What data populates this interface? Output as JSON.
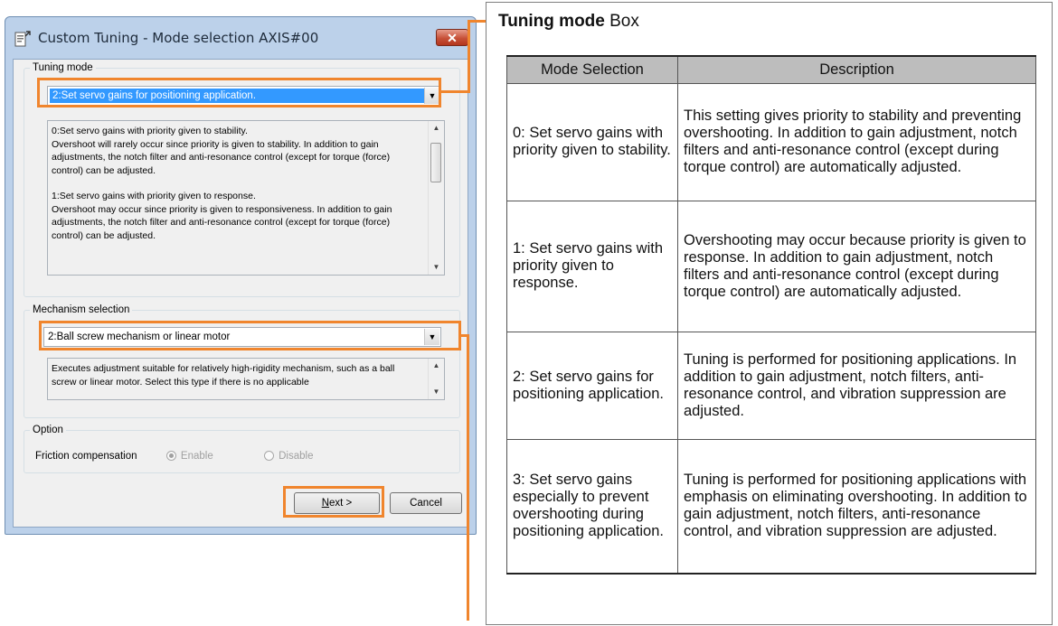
{
  "dialog": {
    "title": "Custom Tuning - Mode selection AXIS#00",
    "close_label": "✕",
    "tuning_mode": {
      "legend": "Tuning mode",
      "selected": "2:Set servo gains for positioning application.",
      "description": [
        "0:Set servo gains with priority given to stability.",
        "Overshoot will rarely occur since priority is given to stability. In addition to gain adjustments, the notch filter and anti-resonance control (except for torque (force) control) can be adjusted.",
        "",
        "1:Set servo gains with priority given to response.",
        "Overshoot may occur since priority is given to responsiveness. In addition to gain adjustments, the notch filter and anti-resonance control (except for torque (force) control) can be adjusted."
      ]
    },
    "mechanism": {
      "legend": "Mechanism selection",
      "selected": "2:Ball screw mechanism or linear motor",
      "description": "Executes adjustment suitable for relatively high-rigidity mechanism, such as a ball screw or linear motor. Select this type if there is no applicable"
    },
    "option": {
      "legend": "Option",
      "label": "Friction compensation",
      "enable": "Enable",
      "disable": "Disable"
    },
    "buttons": {
      "next_prefix": "N",
      "next_rest": "ext >",
      "cancel": "Cancel"
    }
  },
  "panel": {
    "title_bold": "Tuning mode",
    "title_rest": " Box",
    "headers": [
      "Mode Selection",
      "Description"
    ],
    "rows": [
      {
        "mode": "0: Set servo gains with priority given to stability.",
        "desc": "This setting gives priority to stability and preventing overshooting. In addition to gain adjustment, notch filters and anti-resonance control (except during torque control) are automatically adjusted."
      },
      {
        "mode": "1: Set servo gains with priority given to response.",
        "desc": "Overshooting may occur because priority is given to response. In addition to gain adjustment, notch filters and anti-resonance control (except during torque control) are automatically adjusted."
      },
      {
        "mode": "2: Set servo gains for positioning application.",
        "desc": "Tuning is performed for positioning applications. In addition to gain adjustment, notch filters, anti-resonance control, and vibration suppression are adjusted."
      },
      {
        "mode": "3: Set servo gains especially to prevent overshooting during positioning application.",
        "desc": "Tuning is performed for positioning applications with emphasis on eliminating overshooting. In addition to gain adjustment, notch filters, anti-resonance control, and vibration suppression are adjusted."
      }
    ]
  },
  "colors": {
    "highlight": "#f0852d",
    "header_bg": "#bdbdbd",
    "selection": "#3399ff"
  }
}
